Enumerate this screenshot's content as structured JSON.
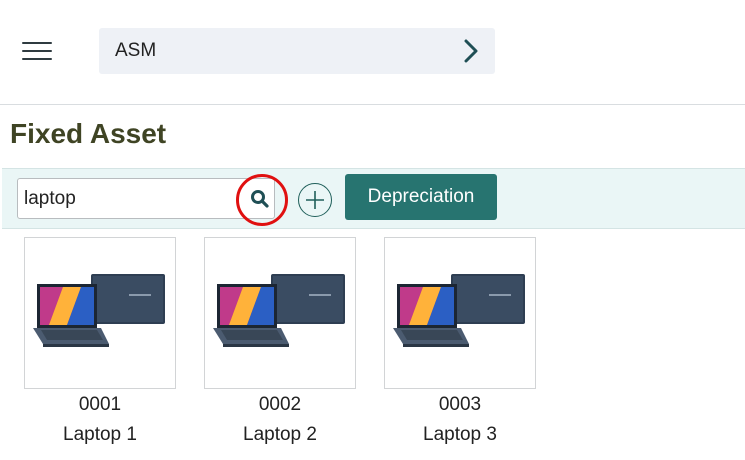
{
  "header": {
    "module_label": "ASM"
  },
  "page": {
    "title": "Fixed Asset"
  },
  "toolbar": {
    "search_value": "laptop",
    "depreciation_label": "Depreciation"
  },
  "assets": [
    {
      "code": "0001",
      "name": "Laptop 1"
    },
    {
      "code": "0002",
      "name": "Laptop 2"
    },
    {
      "code": "0003",
      "name": "Laptop 3"
    }
  ],
  "colors": {
    "accent": "#277470",
    "title": "#3f4424",
    "toolbar_bg": "#eaf6f6",
    "highlight": "#e01010"
  }
}
